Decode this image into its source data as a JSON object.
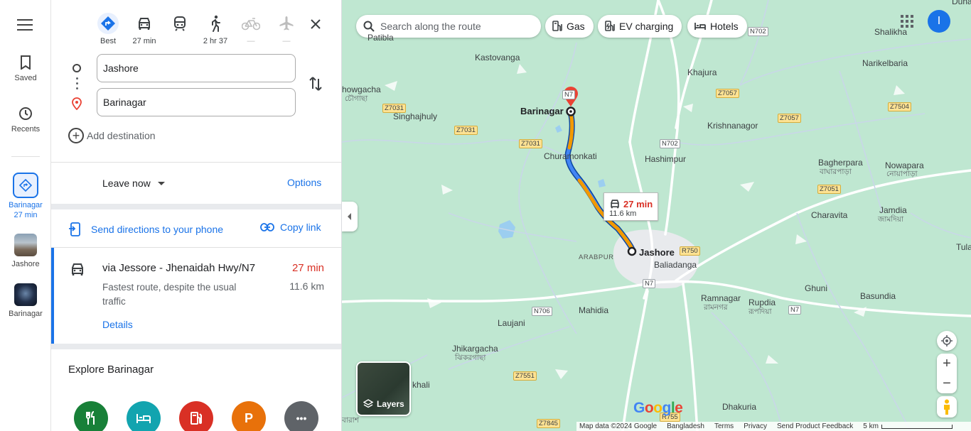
{
  "rail": {
    "saved": "Saved",
    "recents": "Recents",
    "trip_name": "Barinagar",
    "trip_time": "27 min",
    "jashore": "Jashore",
    "barinagar": "Barinagar"
  },
  "modes": [
    {
      "name": "Best",
      "sub": "Best"
    },
    {
      "name": "Driving",
      "sub": "27 min"
    },
    {
      "name": "Transit",
      "sub": ""
    },
    {
      "name": "Walking",
      "sub": "2 hr 37"
    },
    {
      "name": "Cycling",
      "sub": "—"
    },
    {
      "name": "Flights",
      "sub": "—"
    }
  ],
  "origin": "Jashore",
  "destination": "Barinagar",
  "add_destination": "Add destination",
  "leave_now": "Leave now",
  "options": "Options",
  "send_directions": "Send directions to your phone",
  "copy_link": "Copy link",
  "route": {
    "via": "via Jessore - Jhenaidah Hwy/N7",
    "time": "27 min",
    "desc": "Fastest route, despite the usual traffic",
    "distance": "11.6 km",
    "details": "Details"
  },
  "explore_title": "Explore Barinagar",
  "categories": [
    {
      "name": "restaurants",
      "color": "#188038"
    },
    {
      "name": "hotels",
      "color": "#12a4af"
    },
    {
      "name": "gas",
      "color": "#d93025"
    },
    {
      "name": "parking",
      "color": "#e8710a",
      "glyph": "P"
    },
    {
      "name": "more",
      "color": "#5f6368",
      "glyph": "•••"
    }
  ],
  "map": {
    "search_placeholder": "Search along the route",
    "chips": [
      "Gas",
      "EV charging",
      "Hotels"
    ],
    "avatar_letter": "I",
    "route_time": "27 min",
    "route_distance": "11.6 km",
    "layers": "Layers",
    "footer": [
      "Map data ©2024 Google",
      "Bangladesh",
      "Terms",
      "Privacy",
      "Send Product Feedback",
      "5 km"
    ],
    "labels": {
      "kastovanga": "Kastovanga",
      "shalikha": "Shalikha",
      "khajura": "Khajura",
      "narikelbaria": "Narikelbaria",
      "chowgacha": "howgacha",
      "chowgacha_bn": "চৌগাছা",
      "singhajhuly": "Singhajhuly",
      "barinagar": "Barinagar",
      "krishnanagor": "Krishnanagor",
      "churamonkati": "Churamonkati",
      "hashimpur": "Hashimpur",
      "bagherpara": "Bagherpara",
      "bagherpara_bn": "বাঘারপাড়া",
      "nowapara": "Nowapara",
      "nowapara_bn": "নোয়াপাড়া",
      "charavita": "Charavita",
      "jamdia": "Jamdia",
      "jamdia_bn": "জামদিয়া",
      "tula": "Tula",
      "arabpur": "ARABPUR",
      "jashore": "Jashore",
      "baliadanga": "Baliadanga",
      "ramnagar": "Ramnagar",
      "ramnagar_bn": "রামনগর",
      "rupdia": "Rupdia",
      "rupdia_bn": "রূপদিয়া",
      "ghuni": "Ghuni",
      "basundia": "Basundia",
      "mahidia": "Mahidia",
      "laujani": "Laujani",
      "jhikargacha": "Jhikargacha",
      "jhikargacha_bn": "ঝিকরগাছা",
      "khali": "khali",
      "dhakuria": "Dhakuria",
      "patibla": "Patibla",
      "dunaga": "Dunaga",
      "bn_left": "বারাশ"
    },
    "shields": {
      "n702a": "N702",
      "n702b": "N702",
      "n7a": "N7",
      "n7b": "N7",
      "n706": "N706",
      "z7057a": "Z7057",
      "z7057b": "Z7057",
      "z7031a": "Z7031",
      "z7031b": "Z7031",
      "z7031c": "Z7031",
      "z7504": "Z7504",
      "z7051": "Z7051",
      "r750": "R750",
      "r755": "R755",
      "z7551": "Z7551",
      "z7845": "Z7845",
      "n7top": "N7"
    }
  }
}
